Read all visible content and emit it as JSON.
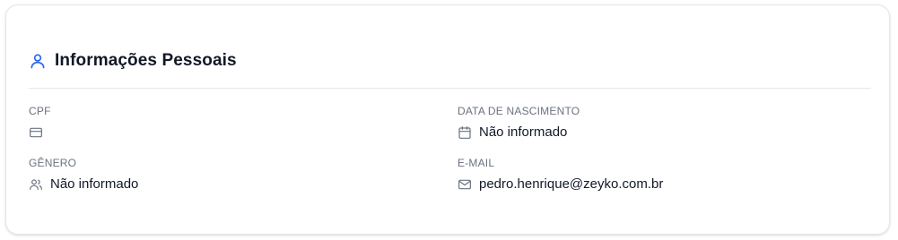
{
  "section": {
    "title": "Informações Pessoais",
    "icon": "user-icon",
    "accent_color": "#2563eb"
  },
  "fields": {
    "cpf": {
      "label": "CPF",
      "icon": "credit-card-icon",
      "value": ""
    },
    "birth_date": {
      "label": "DATA DE NASCIMENTO",
      "icon": "calendar-icon",
      "value": "Não informado"
    },
    "gender": {
      "label": "GÊNERO",
      "icon": "users-icon",
      "value": "Não informado"
    },
    "email": {
      "label": "E-MAIL",
      "icon": "mail-icon",
      "value": "pedro.henrique@zeyko.com.br"
    }
  }
}
